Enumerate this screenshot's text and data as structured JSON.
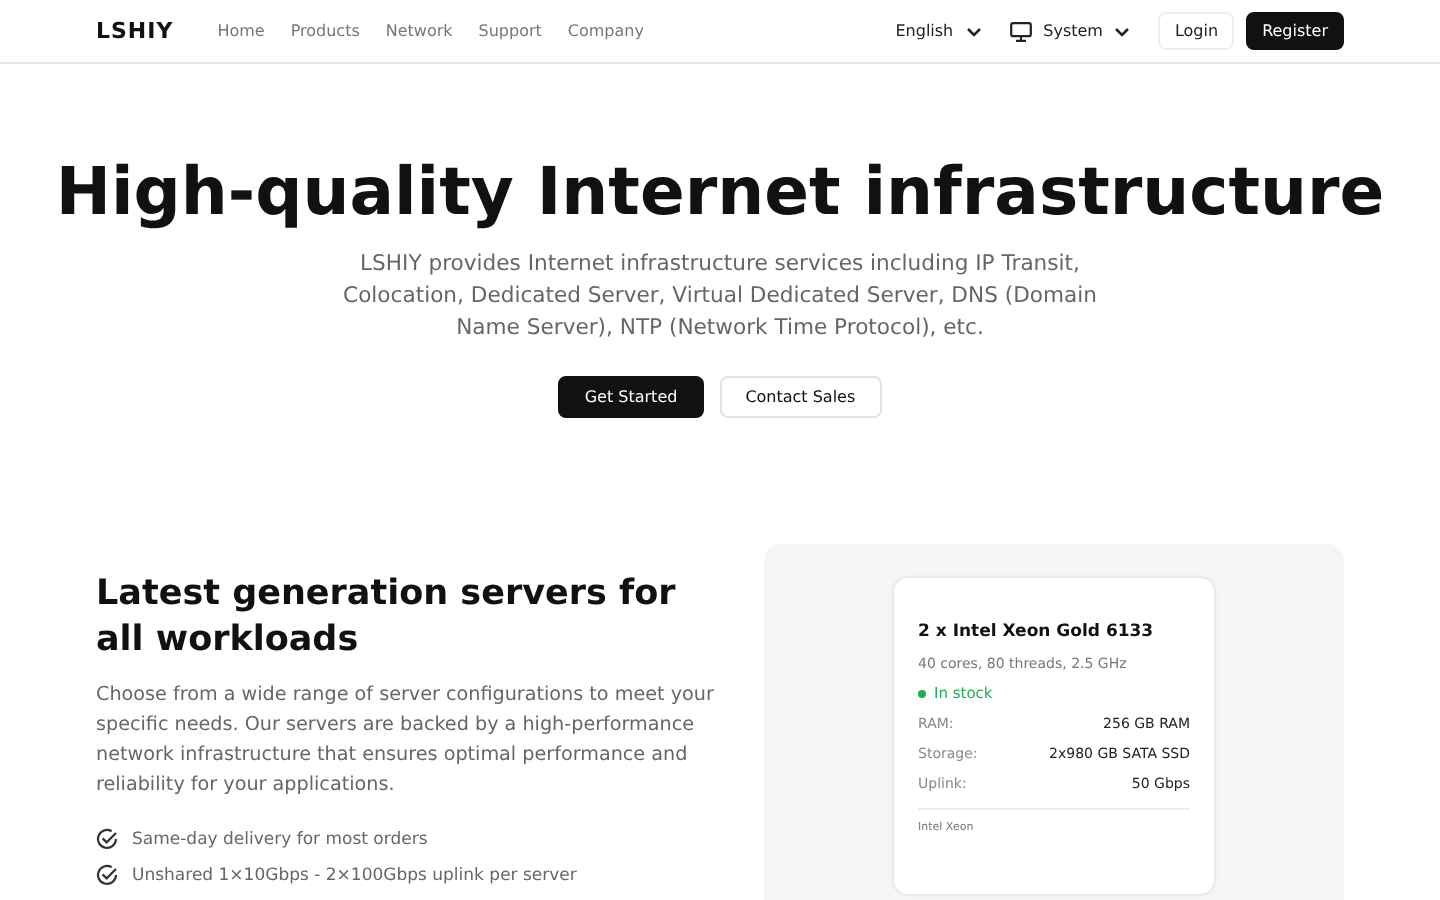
{
  "header": {
    "logo": "LSHIY",
    "nav": [
      {
        "label": "Home"
      },
      {
        "label": "Products"
      },
      {
        "label": "Network"
      },
      {
        "label": "Support"
      },
      {
        "label": "Company"
      }
    ],
    "language": "English",
    "theme": "System",
    "login": "Login",
    "register": "Register"
  },
  "hero": {
    "title": "High-quality Internet infrastructure",
    "subtitle": "LSHIY provides Internet infrastructure services including IP Transit, Colocation, Dedicated Server, Virtual Dedicated Server, DNS (Domain Name Server), NTP (Network Time Protocol), etc.",
    "buttons": [
      {
        "label": "Get Started",
        "kind": "primary"
      },
      {
        "label": "Contact Sales",
        "kind": "secondary"
      }
    ]
  },
  "servers": {
    "title": "Latest generation servers for all workloads",
    "text": "Choose from a wide range of server configurations to meet your specific needs. Our servers are backed by a high-performance network infrastructure that ensures optimal performance and reliability for your applications.",
    "features": [
      "Same-day delivery for most orders",
      "Unshared 1×10Gbps - 2×100Gbps uplink per server"
    ],
    "card": {
      "title": "2 x Intel Xeon Gold 6133",
      "specs": "40 cores, 80 threads, 2.5 GHz",
      "stock": {
        "label": "In stock",
        "available": true
      },
      "rows": [
        {
          "label": "RAM:",
          "value": "256 GB RAM"
        },
        {
          "label": "Storage:",
          "value": "2x980 GB SATA SSD"
        },
        {
          "label": "Uplink:",
          "value": "50 Gbps"
        }
      ],
      "footer": "Intel Xeon"
    }
  }
}
